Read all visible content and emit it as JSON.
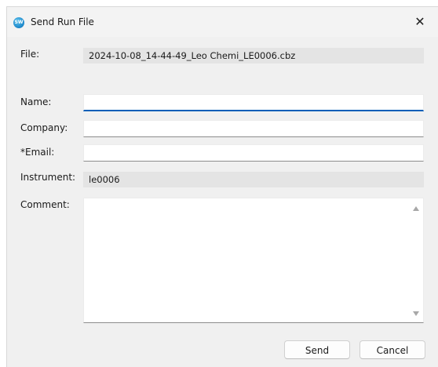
{
  "window": {
    "title": "Send Run File",
    "app_icon_text": "SW"
  },
  "form": {
    "file_label": "File:",
    "file_value": "2024-10-08_14-44-49_Leo Chemi_LE0006.cbz",
    "name_label": "Name:",
    "name_value": "",
    "company_label": "Company:",
    "company_value": "",
    "email_label": "*Email:",
    "email_value": "",
    "instrument_label": "Instrument:",
    "instrument_value": "le0006",
    "comment_label": "Comment:",
    "comment_value": ""
  },
  "buttons": {
    "send": "Send",
    "cancel": "Cancel"
  }
}
